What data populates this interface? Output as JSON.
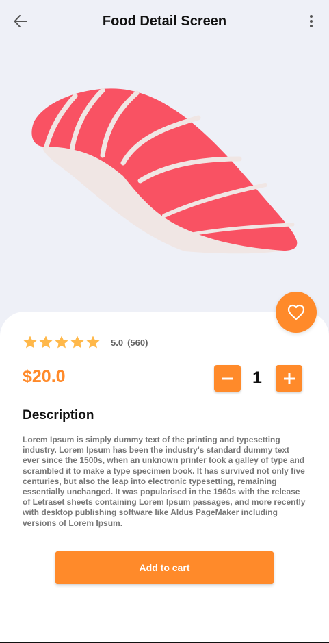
{
  "app_bar": {
    "title": "Food Detail Screen",
    "back_icon": "arrow-left-icon",
    "menu_icon": "more-vertical-icon"
  },
  "hero": {
    "image": "salmon-nigiri-sushi-illustration"
  },
  "favorite": {
    "icon": "heart-outline-icon"
  },
  "rating": {
    "stars": 5,
    "score": "5.0",
    "count": "(560)"
  },
  "price": "$20.0",
  "quantity": {
    "value": "1",
    "decrement_icon": "minus-icon",
    "increment_icon": "plus-icon"
  },
  "description": {
    "heading": "Description",
    "body": "Lorem Ipsum is simply dummy text of the printing and typesetting industry. Lorem Ipsum has been the industry's standard dummy text ever since the 1500s, when an unknown printer took a galley of type and scrambled it to make a type specimen book. It has survived not only five centuries, but also the leap into electronic typesetting, remaining essentially unchanged. It was popularised in the 1960s with the release of Letraset sheets containing Lorem Ipsum passages, and more recently with desktop publishing software like Aldus PageMaker including versions of Lorem Ipsum."
  },
  "cart_button": "Add to cart",
  "colors": {
    "accent": "#ff8a2a",
    "star": "#ffb84a",
    "fish": "#f95263",
    "rice": "#f0e6e4",
    "background": "#eef0f7"
  }
}
